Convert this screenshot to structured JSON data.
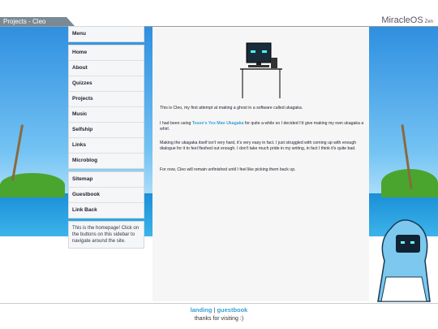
{
  "header": {
    "tab": "Projects - Cleo",
    "brand": "MiracleOS",
    "brand_suffix": "Zen"
  },
  "sidebar": {
    "top": [
      "Menu"
    ],
    "main": [
      "Home",
      "About",
      "Quizzes",
      "Projects",
      "Music",
      "Selfship",
      "Links",
      "Microblog"
    ],
    "bottom": [
      "Sitemap",
      "Guestbook",
      "Link Back"
    ],
    "note": "This is the homepage! Click on the buttons on this sidebar to navigate around the site."
  },
  "content": {
    "p1": "This is Cleo, my first attempt at making a ghost in a software called ukagaka.",
    "p2_pre": "I had been using ",
    "p2_link": "Tosee's Yes Man Ukagaka",
    "p2_post": " for quite a while so I decided I'd give making my own ukagaka a whirl.",
    "p3": "Making the ukagaka itself isn't very hard, it's very easy in fact. I just struggled with coming up with enough dialogue for it to feel fleshed out enough. I don't take much pride in my writing, in fact I think it's quite bad.",
    "p4": "For now, Cleo will remain unfinished until I feel like picking them back up."
  },
  "footer": {
    "link1": "landing",
    "sep": "|",
    "link2": "guestbook",
    "thanks": "thanks for visiting :)"
  },
  "colors": {
    "accent": "#3aa2d4",
    "tab": "#7a8a94"
  }
}
